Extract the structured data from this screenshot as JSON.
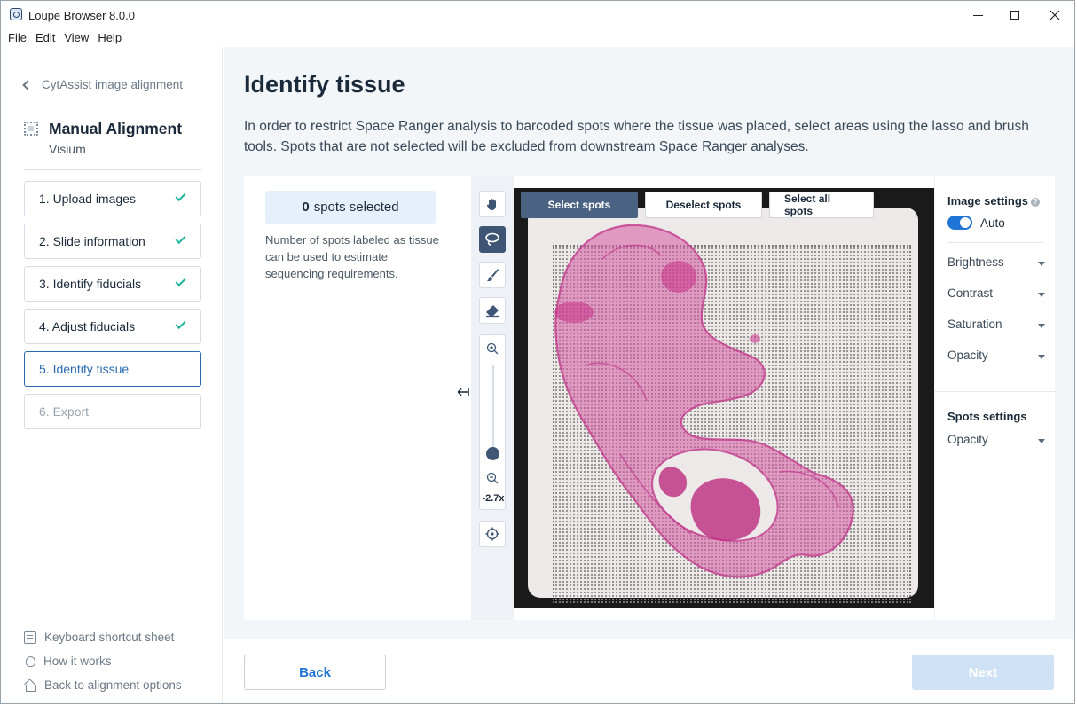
{
  "window": {
    "title": "Loupe Browser 8.0.0"
  },
  "menu": [
    "File",
    "Edit",
    "View",
    "Help"
  ],
  "sidebar": {
    "back_label": "CytAssist image alignment",
    "section_title": "Manual Alignment",
    "section_subtitle": "Visium",
    "steps": [
      {
        "label": "1. Upload images",
        "status": "done"
      },
      {
        "label": "2. Slide information",
        "status": "done"
      },
      {
        "label": "3. Identify fiducials",
        "status": "done"
      },
      {
        "label": "4. Adjust fiducials",
        "status": "done"
      },
      {
        "label": "5. Identify tissue",
        "status": "active"
      },
      {
        "label": "6. Export",
        "status": "disabled"
      }
    ],
    "footer_links": [
      "Keyboard shortcut sheet",
      "How it works",
      "Back to alignment options"
    ]
  },
  "main": {
    "title": "Identify tissue",
    "description": "In order to restrict Space Ranger analysis to barcoded spots where the tissue was placed, select areas using the lasso and brush tools. Spots that are not selected will be excluded from downstream Space Ranger analyses.",
    "spots_count": "0",
    "spots_label": "spots selected",
    "spots_help": "Number of spots labeled as tissue can be used to estimate sequencing requirements.",
    "zoom_level": "-2.7x",
    "viewer_tabs": [
      "Select spots",
      "Deselect spots",
      "Select all spots"
    ],
    "active_tab": "Select spots"
  },
  "image_settings": {
    "title": "Image settings",
    "auto_label": "Auto",
    "auto_enabled": true,
    "controls": [
      "Brightness",
      "Contrast",
      "Saturation",
      "Opacity"
    ]
  },
  "spots_settings": {
    "title": "Spots settings",
    "controls": [
      "Opacity"
    ]
  },
  "footer": {
    "back_label": "Back",
    "next_label": "Next"
  },
  "colors": {
    "accent": "#1f74d6",
    "success": "#1bb39a",
    "tool_active": "#3e5674",
    "tissue": "#d24a9a"
  }
}
